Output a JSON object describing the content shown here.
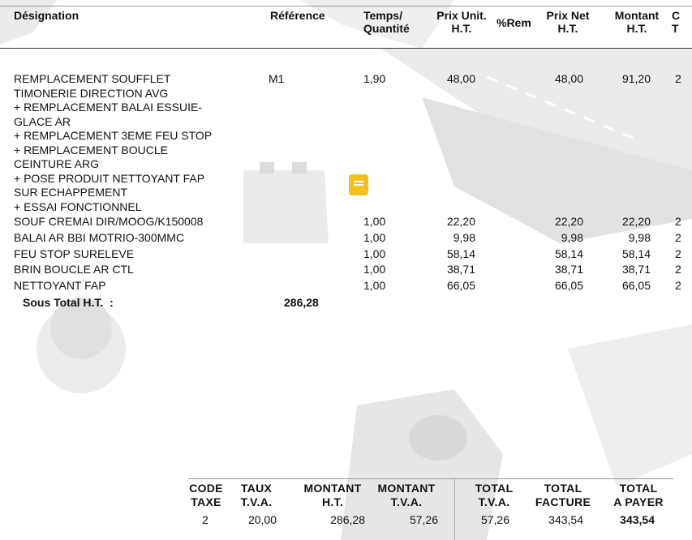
{
  "headers": {
    "designation": "Désignation",
    "reference": "Référence",
    "temps_l1": "Temps/",
    "temps_l2": "Quantité",
    "prix_unit_l1": "Prix Unit.",
    "prix_unit_l2": "H.T.",
    "rem": "%Rem",
    "prix_net_l1": "Prix Net",
    "prix_net_l2": "H.T.",
    "montant_l1": "Montant",
    "montant_l2": "H.T.",
    "ct_l1": "C",
    "ct_l2": "T"
  },
  "main_line": {
    "designation": "REMPLACEMENT SOUFFLET\nTIMONERIE DIRECTION AVG\n+ REMPLACEMENT BALAI ESSUIE-\nGLACE AR\n+ REMPLACEMENT 3EME FEU STOP\n+ REMPLACEMENT BOUCLE\nCEINTURE ARG\n+ POSE PRODUIT NETTOYANT FAP\nSUR ECHAPPEMENT\n+ ESSAI FONCTIONNEL",
    "reference": "M1",
    "temps": "1,90",
    "prix_unit": "48,00",
    "prix_net": "48,00",
    "montant": "91,20",
    "ct": "2"
  },
  "items": [
    {
      "designation": "SOUF CREMAI DIR/MOOG/K150008",
      "qty": "1,00",
      "prix_unit": "22,20",
      "prix_net": "22,20",
      "montant": "22,20",
      "ct": "2"
    },
    {
      "designation": "BALAI AR BBI MOTRIO-300MMC",
      "qty": "1,00",
      "prix_unit": "9,98",
      "prix_net": "9,98",
      "montant": "9,98",
      "ct": "2"
    },
    {
      "designation": "FEU STOP SURELEVE",
      "qty": "1,00",
      "prix_unit": "58,14",
      "prix_net": "58,14",
      "montant": "58,14",
      "ct": "2"
    },
    {
      "designation": "BRIN BOUCLE AR CTL",
      "qty": "1,00",
      "prix_unit": "38,71",
      "prix_net": "38,71",
      "montant": "38,71",
      "ct": "2"
    },
    {
      "designation": "NETTOYANT FAP",
      "qty": "1,00",
      "prix_unit": "66,05",
      "prix_net": "66,05",
      "montant": "66,05",
      "ct": "2"
    }
  ],
  "sous_total": {
    "label": "Sous Total H.T.  :",
    "value": "286,28"
  },
  "totals": {
    "h_code_l1": "CODE",
    "h_code_l2": "TAXE",
    "h_taux_l1": "TAUX",
    "h_taux_l2": "T.V.A.",
    "h_mht_l1": "MONTANT",
    "h_mht_l2": "H.T.",
    "h_mtva_l1": "MONTANT",
    "h_mtva_l2": "T.V.A.",
    "h_ttva_l1": "TOTAL",
    "h_ttva_l2": "T.V.A.",
    "h_tfac_l1": "TOTAL",
    "h_tfac_l2": "FACTURE",
    "h_tpay_l1": "TOTAL",
    "h_tpay_l2": "A PAYER",
    "code": "2",
    "taux": "20,00",
    "montant_ht": "286,28",
    "montant_tva": "57,26",
    "total_tva": "57,26",
    "total_facture": "343,54",
    "total_a_payer": "343,54"
  },
  "comment_icon": "comment-note-icon"
}
